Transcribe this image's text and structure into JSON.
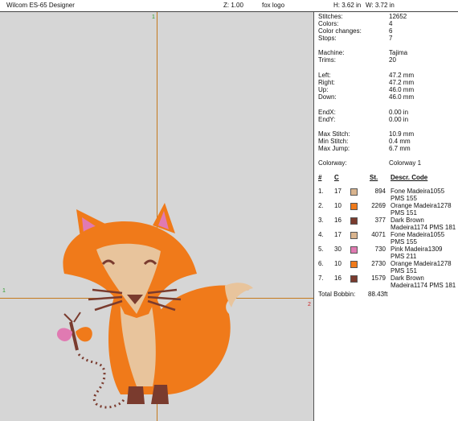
{
  "header": {
    "app_title": "Wilcom ES-65 Designer",
    "zoom": "Z: 1.00",
    "design_name": "fox logo",
    "height": "H: 3.62 in",
    "width": "W: 3.72 in"
  },
  "canvas": {
    "marker_top": "1",
    "marker_left": "1",
    "marker_right": "2"
  },
  "info": {
    "stitches_label": "Stitches:",
    "stitches": "12652",
    "colors_label": "Colors:",
    "colors": "4",
    "color_changes_label": "Color changes:",
    "color_changes": "6",
    "stops_label": "Stops:",
    "stops": "7",
    "machine_label": "Machine:",
    "machine": "Tajima",
    "trims_label": "Trims:",
    "trims": "20",
    "left_label": "Left:",
    "left": "47.2 mm",
    "right_label": "Right:",
    "right": "47.2 mm",
    "up_label": "Up:",
    "up": "46.0 mm",
    "down_label": "Down:",
    "down": "46.0 mm",
    "endx_label": "EndX:",
    "endx": "0.00 in",
    "endy_label": "EndY:",
    "endy": "0.00 in",
    "max_stitch_label": "Max Stitch:",
    "max_stitch": "10.9 mm",
    "min_stitch_label": "Min Stitch:",
    "min_stitch": "0.4 mm",
    "max_jump_label": "Max Jump:",
    "max_jump": "6.7 mm",
    "colorway_label": "Colorway:",
    "colorway": "Colorway 1"
  },
  "thread_table": {
    "headers": [
      "#",
      "C",
      "St.",
      "Descr. Code"
    ],
    "rows": [
      {
        "num": "1.",
        "c": "17",
        "color": "#d9b48e",
        "st": "894",
        "line1": "Fone Madeira1055",
        "line2": "PMS 155"
      },
      {
        "num": "2.",
        "c": "10",
        "color": "#f07a1a",
        "st": "2269",
        "line1": "Orange Madeira1278",
        "line2": "PMS 151"
      },
      {
        "num": "3.",
        "c": "16",
        "color": "#7a3b2e",
        "st": "377",
        "line1": "Dark Brown",
        "line2": "Madeira1174 PMS 181"
      },
      {
        "num": "4.",
        "c": "17",
        "color": "#d9b48e",
        "st": "4071",
        "line1": "Fone Madeira1055",
        "line2": "PMS 155"
      },
      {
        "num": "5.",
        "c": "30",
        "color": "#e07ab2",
        "st": "730",
        "line1": "Pink Madeira1309",
        "line2": "PMS 211"
      },
      {
        "num": "6.",
        "c": "10",
        "color": "#f07a1a",
        "st": "2730",
        "line1": "Orange Madeira1278",
        "line2": "PMS 151"
      },
      {
        "num": "7.",
        "c": "16",
        "color": "#7a3b2e",
        "st": "1579",
        "line1": "Dark Brown",
        "line2": "Madeira1174 PMS 181"
      }
    ]
  },
  "total_bobbin_label": "Total Bobbin:",
  "total_bobbin": "88.43ft"
}
